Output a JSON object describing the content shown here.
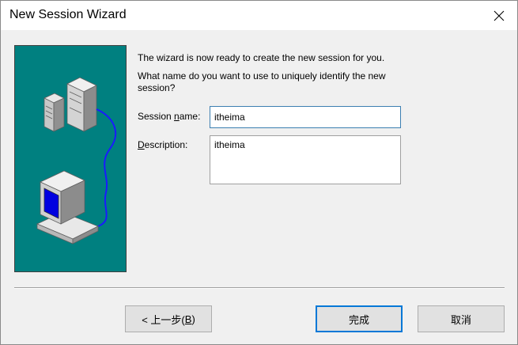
{
  "window": {
    "title": "New Session Wizard"
  },
  "intro": {
    "line1": "The wizard is now ready to create the new session for you.",
    "line2": "What name do you want to use to uniquely identify the new session?"
  },
  "form": {
    "session_name_label_pre": "Session ",
    "session_name_label_ul": "n",
    "session_name_label_post": "ame:",
    "session_name_value": "itheima",
    "description_label_ul": "D",
    "description_label_post": "escription:",
    "description_value": "itheima"
  },
  "buttons": {
    "back_pre": "< 上一步(",
    "back_ul": "B",
    "back_post": ")",
    "finish": "完成",
    "cancel": "取消"
  },
  "colors": {
    "banner_bg": "#008080",
    "focus_border": "#0078d7"
  },
  "icons": {
    "banner": "server-and-workstation-illustration",
    "close": "close-icon"
  }
}
